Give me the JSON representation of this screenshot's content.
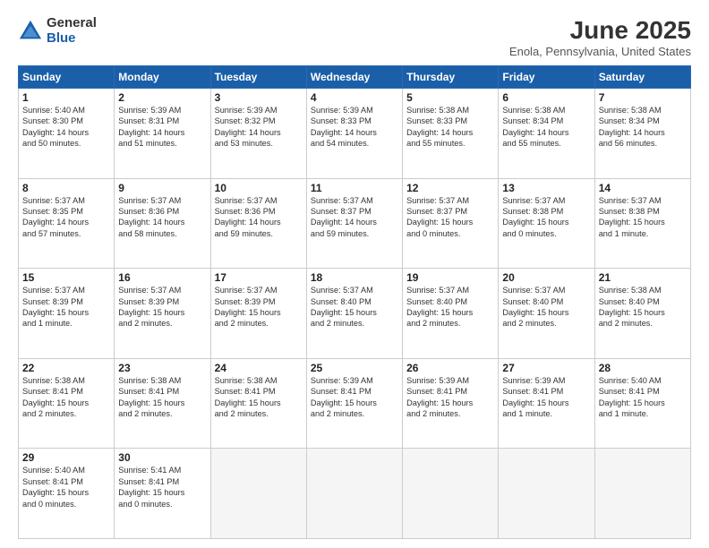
{
  "header": {
    "logo_general": "General",
    "logo_blue": "Blue",
    "month_title": "June 2025",
    "location": "Enola, Pennsylvania, United States"
  },
  "days_of_week": [
    "Sunday",
    "Monday",
    "Tuesday",
    "Wednesday",
    "Thursday",
    "Friday",
    "Saturday"
  ],
  "weeks": [
    [
      {
        "day": "1",
        "info": "Sunrise: 5:40 AM\nSunset: 8:30 PM\nDaylight: 14 hours\nand 50 minutes."
      },
      {
        "day": "2",
        "info": "Sunrise: 5:39 AM\nSunset: 8:31 PM\nDaylight: 14 hours\nand 51 minutes."
      },
      {
        "day": "3",
        "info": "Sunrise: 5:39 AM\nSunset: 8:32 PM\nDaylight: 14 hours\nand 53 minutes."
      },
      {
        "day": "4",
        "info": "Sunrise: 5:39 AM\nSunset: 8:33 PM\nDaylight: 14 hours\nand 54 minutes."
      },
      {
        "day": "5",
        "info": "Sunrise: 5:38 AM\nSunset: 8:33 PM\nDaylight: 14 hours\nand 55 minutes."
      },
      {
        "day": "6",
        "info": "Sunrise: 5:38 AM\nSunset: 8:34 PM\nDaylight: 14 hours\nand 55 minutes."
      },
      {
        "day": "7",
        "info": "Sunrise: 5:38 AM\nSunset: 8:34 PM\nDaylight: 14 hours\nand 56 minutes."
      }
    ],
    [
      {
        "day": "8",
        "info": "Sunrise: 5:37 AM\nSunset: 8:35 PM\nDaylight: 14 hours\nand 57 minutes."
      },
      {
        "day": "9",
        "info": "Sunrise: 5:37 AM\nSunset: 8:36 PM\nDaylight: 14 hours\nand 58 minutes."
      },
      {
        "day": "10",
        "info": "Sunrise: 5:37 AM\nSunset: 8:36 PM\nDaylight: 14 hours\nand 59 minutes."
      },
      {
        "day": "11",
        "info": "Sunrise: 5:37 AM\nSunset: 8:37 PM\nDaylight: 14 hours\nand 59 minutes."
      },
      {
        "day": "12",
        "info": "Sunrise: 5:37 AM\nSunset: 8:37 PM\nDaylight: 15 hours\nand 0 minutes."
      },
      {
        "day": "13",
        "info": "Sunrise: 5:37 AM\nSunset: 8:38 PM\nDaylight: 15 hours\nand 0 minutes."
      },
      {
        "day": "14",
        "info": "Sunrise: 5:37 AM\nSunset: 8:38 PM\nDaylight: 15 hours\nand 1 minute."
      }
    ],
    [
      {
        "day": "15",
        "info": "Sunrise: 5:37 AM\nSunset: 8:39 PM\nDaylight: 15 hours\nand 1 minute."
      },
      {
        "day": "16",
        "info": "Sunrise: 5:37 AM\nSunset: 8:39 PM\nDaylight: 15 hours\nand 2 minutes."
      },
      {
        "day": "17",
        "info": "Sunrise: 5:37 AM\nSunset: 8:39 PM\nDaylight: 15 hours\nand 2 minutes."
      },
      {
        "day": "18",
        "info": "Sunrise: 5:37 AM\nSunset: 8:40 PM\nDaylight: 15 hours\nand 2 minutes."
      },
      {
        "day": "19",
        "info": "Sunrise: 5:37 AM\nSunset: 8:40 PM\nDaylight: 15 hours\nand 2 minutes."
      },
      {
        "day": "20",
        "info": "Sunrise: 5:37 AM\nSunset: 8:40 PM\nDaylight: 15 hours\nand 2 minutes."
      },
      {
        "day": "21",
        "info": "Sunrise: 5:38 AM\nSunset: 8:40 PM\nDaylight: 15 hours\nand 2 minutes."
      }
    ],
    [
      {
        "day": "22",
        "info": "Sunrise: 5:38 AM\nSunset: 8:41 PM\nDaylight: 15 hours\nand 2 minutes."
      },
      {
        "day": "23",
        "info": "Sunrise: 5:38 AM\nSunset: 8:41 PM\nDaylight: 15 hours\nand 2 minutes."
      },
      {
        "day": "24",
        "info": "Sunrise: 5:38 AM\nSunset: 8:41 PM\nDaylight: 15 hours\nand 2 minutes."
      },
      {
        "day": "25",
        "info": "Sunrise: 5:39 AM\nSunset: 8:41 PM\nDaylight: 15 hours\nand 2 minutes."
      },
      {
        "day": "26",
        "info": "Sunrise: 5:39 AM\nSunset: 8:41 PM\nDaylight: 15 hours\nand 2 minutes."
      },
      {
        "day": "27",
        "info": "Sunrise: 5:39 AM\nSunset: 8:41 PM\nDaylight: 15 hours\nand 1 minute."
      },
      {
        "day": "28",
        "info": "Sunrise: 5:40 AM\nSunset: 8:41 PM\nDaylight: 15 hours\nand 1 minute."
      }
    ],
    [
      {
        "day": "29",
        "info": "Sunrise: 5:40 AM\nSunset: 8:41 PM\nDaylight: 15 hours\nand 0 minutes."
      },
      {
        "day": "30",
        "info": "Sunrise: 5:41 AM\nSunset: 8:41 PM\nDaylight: 15 hours\nand 0 minutes."
      },
      {
        "day": "",
        "info": ""
      },
      {
        "day": "",
        "info": ""
      },
      {
        "day": "",
        "info": ""
      },
      {
        "day": "",
        "info": ""
      },
      {
        "day": "",
        "info": ""
      }
    ]
  ]
}
